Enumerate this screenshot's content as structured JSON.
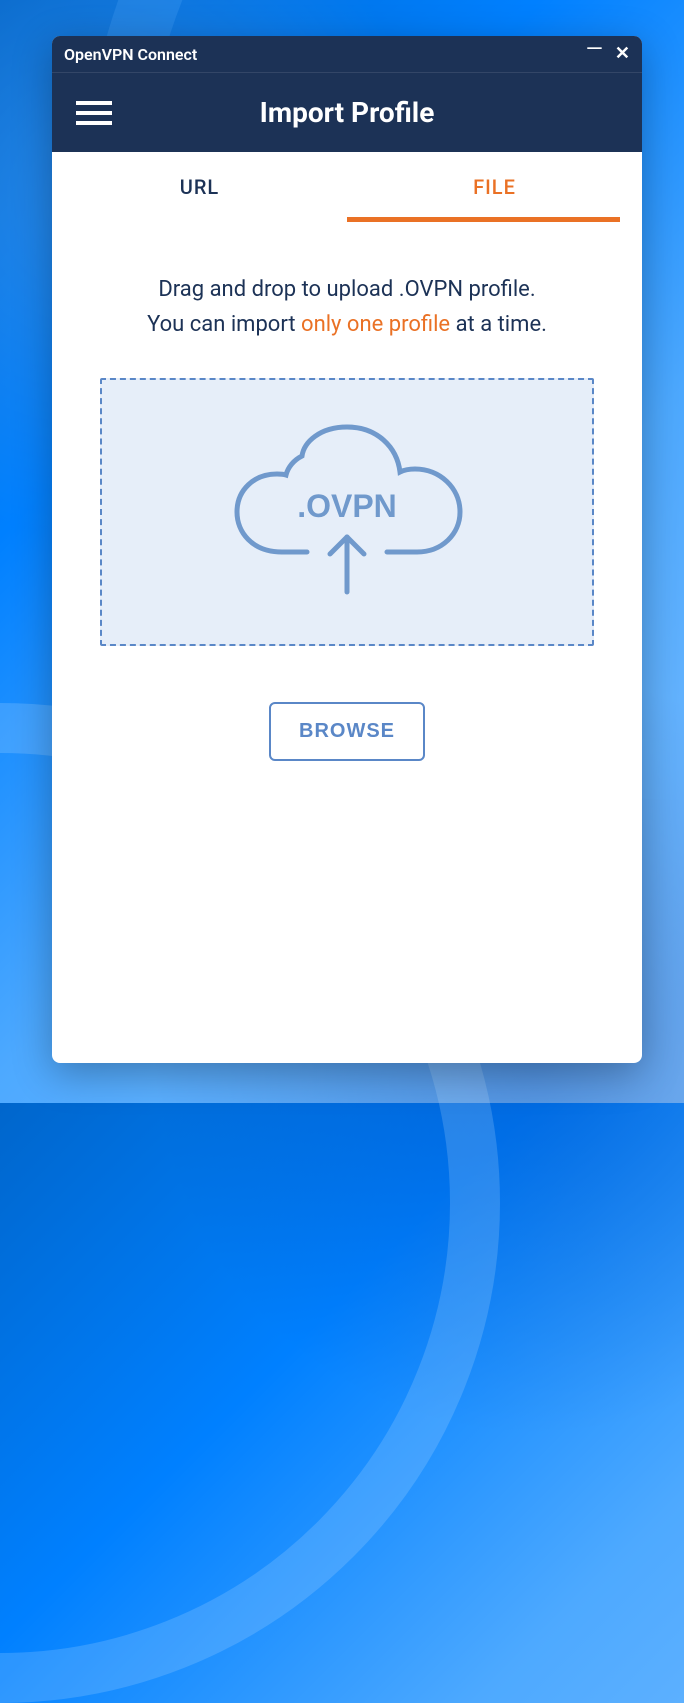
{
  "titlebar": {
    "title": "OpenVPN Connect"
  },
  "header": {
    "title": "Import Profile"
  },
  "tabs": {
    "url": "URL",
    "file": "FILE"
  },
  "instructions": {
    "line1": "Drag and drop to upload .OVPN profile.",
    "line2_before": "You can import ",
    "line2_highlight": "only one profile",
    "line2_after": " at a time."
  },
  "dropzone": {
    "label": ".OVPN"
  },
  "browse": {
    "label": "BROWSE"
  },
  "colors": {
    "primary": "#1c3256",
    "accent": "#ea7125",
    "dropzone_bg": "#e6eef9",
    "dropzone_border": "#5a87c7"
  }
}
